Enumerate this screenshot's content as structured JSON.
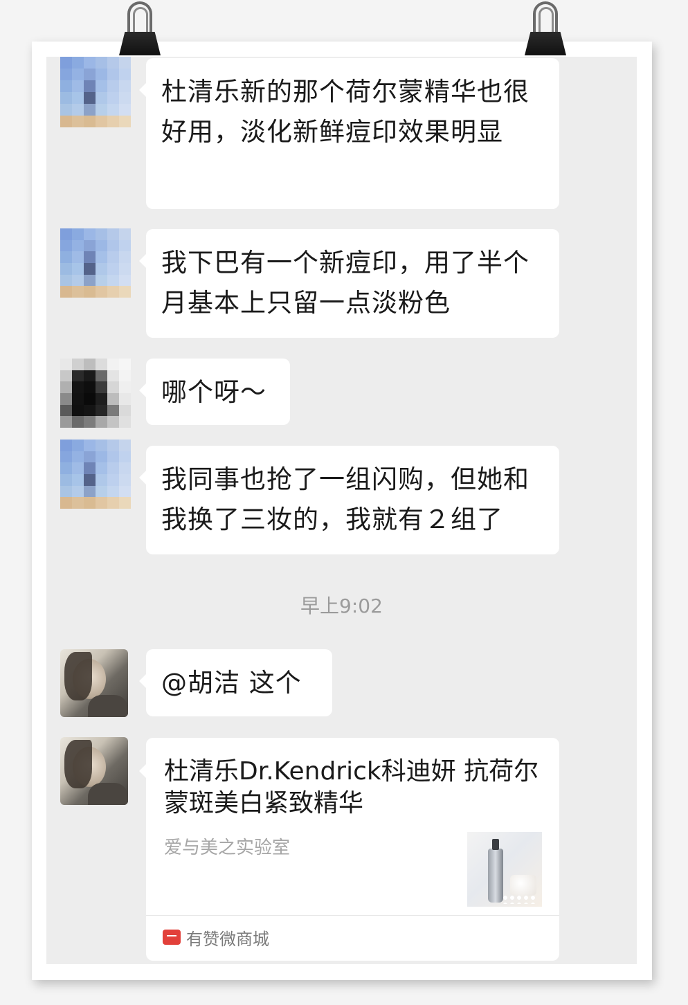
{
  "messages": [
    {
      "sender": "blur-sky",
      "text": "杜清乐新的那个荷尔蒙精华也很好用，淡化新鲜痘印效果明显"
    },
    {
      "sender": "blur-sky",
      "text": "我下巴有一个新痘印，用了半个月基本上只留一点淡粉色"
    },
    {
      "sender": "blur-dark",
      "text": "哪个呀～"
    },
    {
      "sender": "blur-sky",
      "text": "我同事也抢了一组闪购，但她和我换了三妆的，我就有２组了"
    },
    {
      "sender": "woman-photo",
      "text": "@胡洁  这个"
    }
  ],
  "timestamp": "早上9:02",
  "share_card": {
    "title": "杜清乐Dr.Kendrick科迪妍 抗荷尔蒙斑美白紧致精华",
    "source": "爱与美之实验室",
    "footer": "有赞微商城"
  },
  "colors": {
    "chat_background": "#ededed",
    "bubble": "#ffffff",
    "shop_icon": "#e2403a"
  }
}
